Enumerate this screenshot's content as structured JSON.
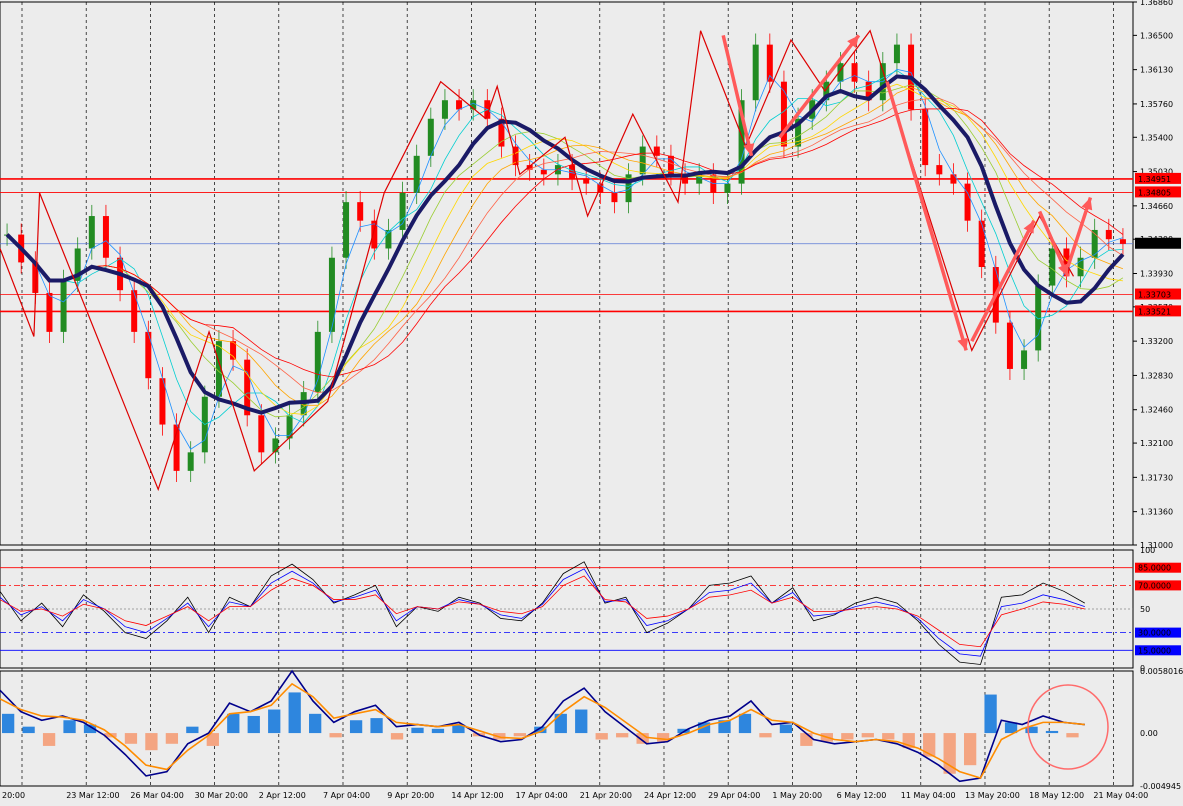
{
  "chart_data": [
    {
      "type": "candlestick",
      "panel": "price",
      "symbol_note": "",
      "y_ticks": [
        "1.36860",
        "1.36500",
        "1.36130",
        "1.35760",
        "1.35400",
        "1.35030",
        "1.34660",
        "1.34300",
        "1.33930",
        "1.33570",
        "1.33200",
        "1.32830",
        "1.32460",
        "1.32100",
        "1.31730",
        "1.31360",
        "1.31000"
      ],
      "ylim": [
        1.31,
        1.3686
      ],
      "price_labels": [
        {
          "text": "1.34951",
          "kind": "line-red",
          "price": 1.34951
        },
        {
          "text": "1.34805",
          "kind": "line-red",
          "price": 1.34805
        },
        {
          "text": "1.34251",
          "kind": "current",
          "price": 1.34251
        },
        {
          "text": "1.33703",
          "kind": "line-red",
          "price": 1.33703
        },
        {
          "text": "1.33521",
          "kind": "line-red",
          "price": 1.33521
        }
      ],
      "horizontal_levels": [
        1.34951,
        1.34805,
        1.33703,
        1.33521
      ],
      "current_price": 1.34251,
      "close_series": [
        1.3435,
        1.3405,
        1.3372,
        1.333,
        1.3385,
        1.342,
        1.3455,
        1.341,
        1.3375,
        1.333,
        1.328,
        1.323,
        1.318,
        1.32,
        1.326,
        1.332,
        1.33,
        1.324,
        1.32,
        1.3215,
        1.324,
        1.3265,
        1.333,
        1.341,
        1.347,
        1.345,
        1.342,
        1.344,
        1.348,
        1.352,
        1.356,
        1.358,
        1.357,
        1.358,
        1.356,
        1.353,
        1.351,
        1.3505,
        1.35,
        1.351,
        1.3495,
        1.349,
        1.348,
        1.347,
        1.35,
        1.353,
        1.352,
        1.35,
        1.349,
        1.35,
        1.348,
        1.349,
        1.358,
        1.364,
        1.36,
        1.353,
        1.356,
        1.358,
        1.36,
        1.362,
        1.36,
        1.358,
        1.362,
        1.364,
        1.357,
        1.351,
        1.35,
        1.349,
        1.345,
        1.34,
        1.334,
        1.329,
        1.331,
        1.338,
        1.342,
        1.339,
        1.341,
        1.344,
        1.343,
        1.3425
      ],
      "zigzag_points": [
        [
          0.0,
          1.342
        ],
        [
          0.03,
          1.3325
        ],
        [
          0.035,
          1.348
        ],
        [
          0.14,
          1.316
        ],
        [
          0.185,
          1.333
        ],
        [
          0.225,
          1.318
        ],
        [
          0.29,
          1.3255
        ],
        [
          0.34,
          1.348
        ],
        [
          0.39,
          1.36
        ],
        [
          0.43,
          1.356
        ],
        [
          0.44,
          1.3595
        ],
        [
          0.46,
          1.35
        ],
        [
          0.5,
          1.354
        ],
        [
          0.52,
          1.3455
        ],
        [
          0.56,
          1.3565
        ],
        [
          0.6,
          1.347
        ],
        [
          0.62,
          1.3655
        ],
        [
          0.66,
          1.353
        ],
        [
          0.7,
          1.3645
        ],
        [
          0.73,
          1.359
        ],
        [
          0.77,
          1.3655
        ],
        [
          0.86,
          1.331
        ],
        [
          0.92,
          1.3455
        ],
        [
          0.95,
          1.339
        ]
      ],
      "red_arrows": [
        {
          "from": [
            0.64,
            1.365
          ],
          "to": [
            0.665,
            1.352
          ]
        },
        {
          "from": [
            0.69,
            1.354
          ],
          "to": [
            0.76,
            1.365
          ]
        },
        {
          "from": [
            0.785,
            1.36
          ],
          "to": [
            0.855,
            1.331
          ]
        },
        {
          "from": [
            0.86,
            1.332
          ],
          "to": [
            0.915,
            1.345
          ]
        },
        {
          "from": [
            0.92,
            1.346
          ],
          "to": [
            0.945,
            1.339
          ]
        },
        {
          "from": [
            0.945,
            1.34
          ],
          "to": [
            0.965,
            1.3475
          ]
        }
      ]
    },
    {
      "type": "line",
      "panel": "rsi",
      "y_ticks": [
        "100",
        "50",
        "0"
      ],
      "ylim": [
        0,
        100
      ],
      "levels": [
        {
          "value": 85,
          "label": "85.0000",
          "color": "#ff0000"
        },
        {
          "value": 70,
          "label": "70.0000",
          "color": "#ff0000"
        },
        {
          "value": 30,
          "label": "30.0000",
          "color": "#0000ff"
        },
        {
          "value": 15,
          "label": "15.0000",
          "color": "#0000ff"
        }
      ],
      "series": [
        {
          "color": "#000000",
          "values": [
            65,
            40,
            55,
            35,
            62,
            48,
            30,
            25,
            40,
            60,
            30,
            60,
            52,
            78,
            88,
            75,
            55,
            62,
            70,
            35,
            52,
            48,
            60,
            55,
            42,
            40,
            55,
            80,
            90,
            55,
            60,
            30,
            38,
            50,
            70,
            72,
            78,
            55,
            68,
            40,
            45,
            55,
            60,
            55,
            40,
            20,
            5,
            3,
            60,
            62,
            72,
            65,
            55
          ]
        },
        {
          "color": "#0000ff",
          "values": [
            60,
            45,
            52,
            40,
            58,
            50,
            35,
            30,
            42,
            55,
            35,
            56,
            52,
            72,
            82,
            72,
            56,
            60,
            66,
            40,
            52,
            50,
            58,
            54,
            45,
            42,
            54,
            75,
            84,
            56,
            58,
            36,
            40,
            50,
            64,
            66,
            72,
            55,
            64,
            44,
            46,
            52,
            56,
            52,
            42,
            25,
            12,
            10,
            52,
            55,
            62,
            58,
            52
          ]
        },
        {
          "color": "#ff0000",
          "values": [
            58,
            48,
            50,
            44,
            54,
            50,
            40,
            36,
            44,
            52,
            40,
            52,
            52,
            66,
            76,
            70,
            58,
            58,
            62,
            46,
            52,
            50,
            56,
            54,
            48,
            46,
            52,
            70,
            78,
            58,
            56,
            42,
            44,
            50,
            60,
            62,
            66,
            55,
            60,
            48,
            48,
            50,
            52,
            50,
            44,
            32,
            20,
            18,
            45,
            50,
            56,
            54,
            50
          ]
        }
      ]
    },
    {
      "type": "bar",
      "panel": "macd",
      "y_ticks": [
        "0.0058016",
        "0.00",
        "-0.004945"
      ],
      "ylim": [
        -0.004945,
        0.0058016
      ],
      "histogram": [
        0.0018,
        0.0006,
        -0.0012,
        0.0012,
        0.0008,
        -0.0004,
        -0.001,
        -0.0016,
        -0.001,
        0.0006,
        -0.0012,
        0.0018,
        0.0016,
        0.0022,
        0.0038,
        0.0018,
        -0.0004,
        0.0012,
        0.0014,
        -0.0006,
        0.0005,
        0.0004,
        0.0008,
        -0.0003,
        -0.0006,
        -0.0003,
        0.0006,
        0.0018,
        0.0022,
        -0.0006,
        -0.0004,
        -0.001,
        -0.0008,
        0.0004,
        0.001,
        0.0012,
        0.0018,
        -0.0004,
        0.0008,
        -0.0012,
        -0.0008,
        -0.0006,
        -0.0004,
        -0.0006,
        -0.0014,
        -0.0022,
        -0.0038,
        -0.003,
        0.0036,
        0.001,
        0.0006,
        0.0002,
        -0.0004
      ],
      "series": [
        {
          "color": "#00008b",
          "values": [
            0.004,
            0.002,
            0.0012,
            0.0016,
            0.001,
            -0.0002,
            -0.002,
            -0.004,
            -0.0036,
            -0.001,
            0.0,
            0.0028,
            0.002,
            0.003,
            0.0058,
            0.003,
            0.001,
            0.002,
            0.0026,
            0.0006,
            0.0008,
            0.0006,
            0.001,
            -0.0002,
            -0.0008,
            -0.0006,
            0.0006,
            0.003,
            0.0042,
            0.002,
            0.0005,
            -0.001,
            -0.0008,
            0.0004,
            0.0012,
            0.0016,
            0.003,
            0.0008,
            0.001,
            -0.0006,
            -0.001,
            -0.0008,
            -0.0006,
            -0.001,
            -0.0018,
            -0.003,
            -0.0045,
            -0.0042,
            0.0012,
            0.0008,
            0.0016,
            0.001,
            0.0008
          ]
        },
        {
          "color": "#ff8c00",
          "values": [
            0.0032,
            0.0022,
            0.0016,
            0.0015,
            0.0012,
            0.0003,
            -0.0012,
            -0.003,
            -0.0034,
            -0.0016,
            -0.0002,
            0.0018,
            0.002,
            0.0026,
            0.0046,
            0.0034,
            0.0014,
            0.0018,
            0.0022,
            0.001,
            0.0008,
            0.0006,
            0.0008,
            0.0002,
            -0.0004,
            -0.0005,
            0.0002,
            0.002,
            0.0034,
            0.0024,
            0.001,
            -0.0004,
            -0.0006,
            0.0,
            0.0008,
            0.0012,
            0.0022,
            0.0012,
            0.001,
            0.0,
            -0.0006,
            -0.0008,
            -0.0006,
            -0.0008,
            -0.0014,
            -0.0024,
            -0.0036,
            -0.0042,
            -0.0006,
            0.0004,
            0.001,
            0.001,
            0.0008
          ]
        }
      ]
    }
  ],
  "x_ticks": [
    "20:00",
    "23 Mar 12:00",
    "26 Mar 04:00",
    "30 Mar 20:00",
    "2 Apr 12:00",
    "7 Apr 04:00",
    "9 Apr 20:00",
    "14 Apr 12:00",
    "17 Apr 04:00",
    "21 Apr 20:00",
    "24 Apr 12:00",
    "29 Apr 04:00",
    "1 May 20:00",
    "6 May 12:00",
    "11 May 04:00",
    "13 May 20:00",
    "18 May 12:00",
    "21 May 04:00"
  ],
  "colors": {
    "background": "#ececec",
    "level_red": "#ff0000",
    "zigzag": "#dd0000",
    "arrow": "#ff5a5a",
    "slow_ma": "#1a1a66"
  }
}
